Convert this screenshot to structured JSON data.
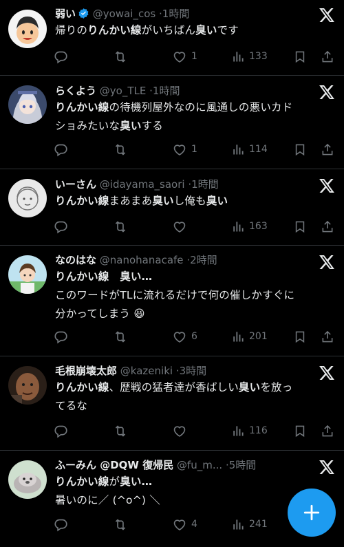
{
  "tweets": [
    {
      "name": "弱い",
      "verified": true,
      "handle": "@yowai_cos",
      "separator": "·",
      "time": "1時間",
      "text_html": "帰りの<b>りんかい線</b>がいちばん<b>臭い</b>です",
      "reply_count": "",
      "retweet_count": "",
      "like_count": "1",
      "view_count": "133",
      "avatar_icon": "cartoon-face-avatar"
    },
    {
      "name": "らくよう",
      "verified": false,
      "handle": "@yo_TLE",
      "separator": "·",
      "time": "1時間",
      "text_html": "<b>りんかい線</b>の待機列屋外なのに風通しの悪いカド<br>ショみたいな<b>臭い</b>する",
      "reply_count": "",
      "retweet_count": "",
      "like_count": "1",
      "view_count": "114",
      "avatar_icon": "anime-girl-avatar"
    },
    {
      "name": "いーさん",
      "verified": false,
      "handle": "@idayama_saori",
      "separator": "·",
      "time": "1時間",
      "text_html": "<b>りんかい線</b>まあまあ<b>臭い</b>し俺も<b>臭い</b>",
      "reply_count": "",
      "retweet_count": "",
      "like_count": "",
      "view_count": "163",
      "avatar_icon": "sketch-avatar"
    },
    {
      "name": "なのはな",
      "verified": false,
      "handle": "@nanohanacafe",
      "separator": "·",
      "time": "2時間",
      "text_html": "<b>りんかい線　臭い…</b><br>このワードがTLに流れるだけで何の催しかすぐに<br>分かってしまう 😆",
      "reply_count": "",
      "retweet_count": "",
      "like_count": "6",
      "view_count": "201",
      "avatar_icon": "anime-boy-avatar"
    },
    {
      "name": "毛根崩壊太郎",
      "verified": false,
      "handle": "@kazeniki",
      "separator": "·",
      "time": "3時間",
      "text_html": "<b>りんかい線</b>、歴戦の猛者達が香ばしい<b>臭い</b>を放っ<br>てるな",
      "reply_count": "",
      "retweet_count": "",
      "like_count": "",
      "view_count": "116",
      "avatar_icon": "photo-face-avatar"
    },
    {
      "name": "ふーみん @DQW 復帰民",
      "verified": false,
      "handle": "@fu_m...",
      "separator": "·",
      "time": "5時間",
      "text_html": "<b>りんかい線</b>が<b>臭い…</b><br>暑いのに／ (^o^) ＼",
      "reply_count": "",
      "retweet_count": "",
      "like_count": "4",
      "view_count": "241",
      "avatar_icon": "seal-avatar"
    }
  ],
  "colors": {
    "background": "#000000",
    "text": "#e7e9ea",
    "muted": "#71767b",
    "accent": "#1d9bf0",
    "divider": "#2f3336"
  },
  "icons": {
    "platform": "x-logo-icon",
    "reply": "reply-icon",
    "retweet": "retweet-icon",
    "like": "heart-icon",
    "views": "views-icon",
    "bookmark": "bookmark-icon",
    "share": "share-icon",
    "compose": "plus-icon"
  }
}
